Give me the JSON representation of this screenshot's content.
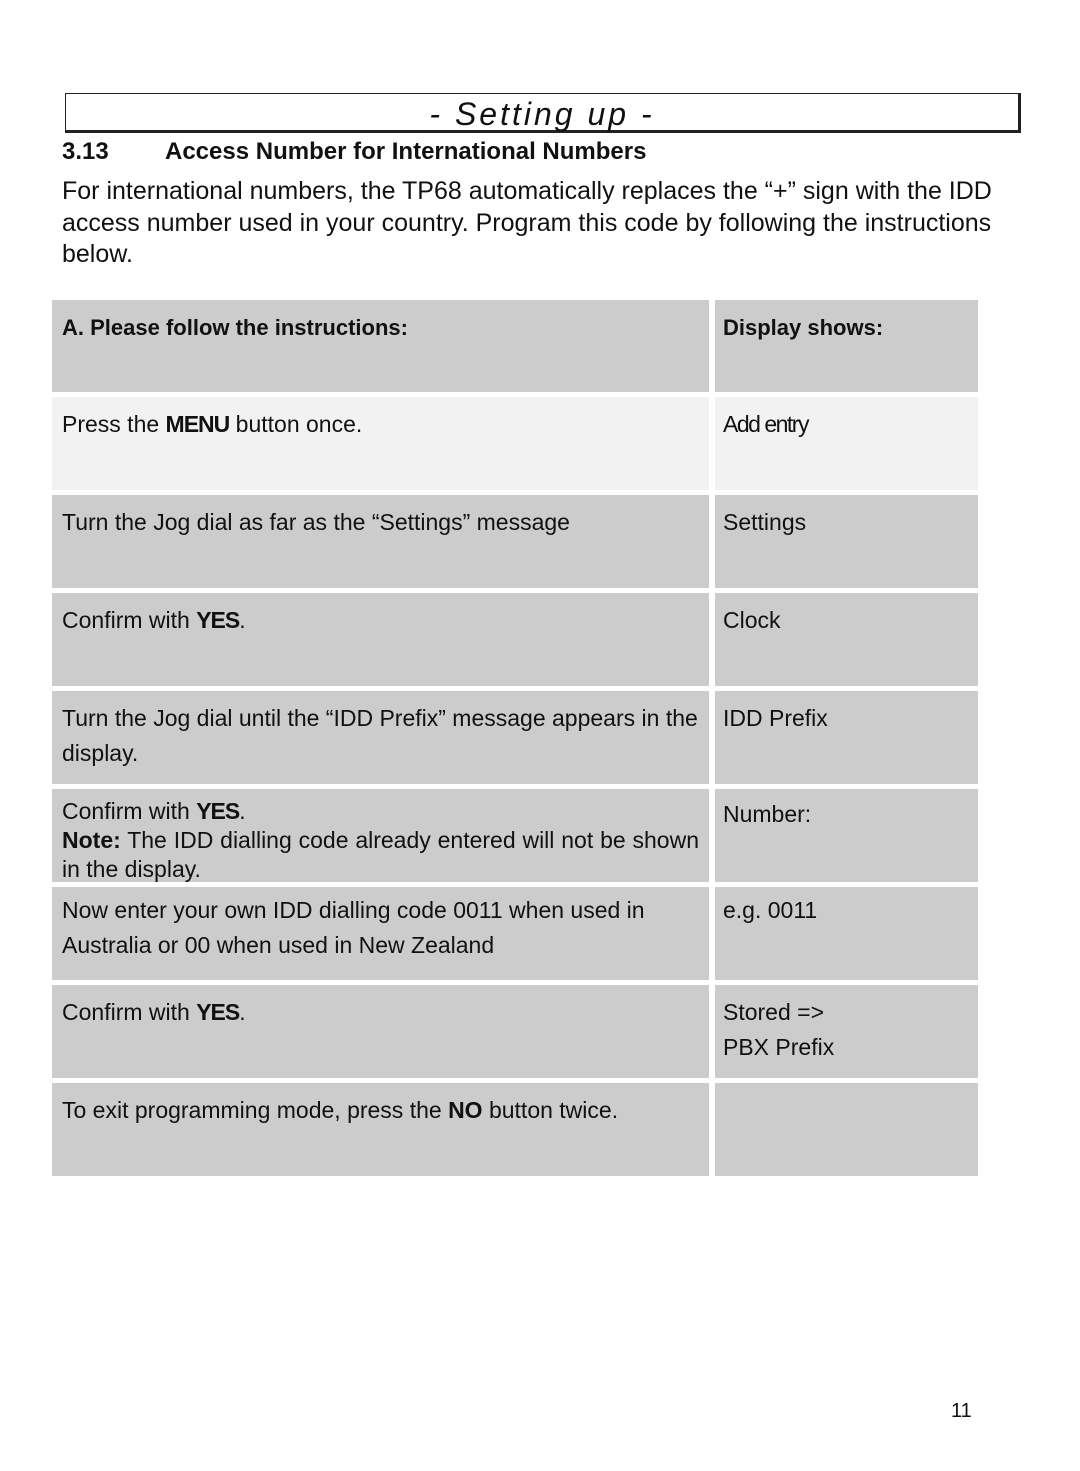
{
  "header": {
    "title": "- Setting up -"
  },
  "section": {
    "number": "3.13",
    "title": "Access Number for International Numbers"
  },
  "intro": "For international numbers, the TP68 automatically replaces the “+” sign with the IDD access number used in your country. Program this code by following the instructions below.",
  "table": {
    "headers": {
      "instructions": "A. Please follow the instructions:",
      "display": "Display shows:"
    },
    "rows": [
      {
        "pre": "Press the ",
        "bold": "MENU",
        "post": " button once.",
        "display": "Add entry"
      },
      {
        "pre": "Turn the Jog dial as far as the “Settings” message",
        "bold": "",
        "post": "",
        "display": "Settings"
      },
      {
        "pre": "Confirm with ",
        "bold": "YES",
        "post": ".",
        "display": "Clock"
      },
      {
        "pre": "Turn the Jog dial until the “IDD Prefix” message appears in the display.",
        "bold": "",
        "post": "",
        "display": "IDD Prefix"
      },
      {
        "pre": "Confirm with ",
        "bold": "YES",
        "post": ".",
        "note_label": "Note:",
        "note_text": " The IDD dialling code already entered will not be shown in the display.",
        "display": "Number:"
      },
      {
        "pre": "Now enter your own IDD  dialling code 0011 when used in Australia or 00 when used in New Zealand",
        "bold": "",
        "post": "",
        "display": "e.g. 0011"
      },
      {
        "pre": "Confirm with ",
        "bold": "YES",
        "post": ".",
        "display": "Stored =>",
        "display2": "PBX Prefix"
      },
      {
        "pre": "To exit programming mode, press the ",
        "bold": "NO",
        "post": " button twice.",
        "display": ""
      }
    ]
  },
  "page_number": "11"
}
